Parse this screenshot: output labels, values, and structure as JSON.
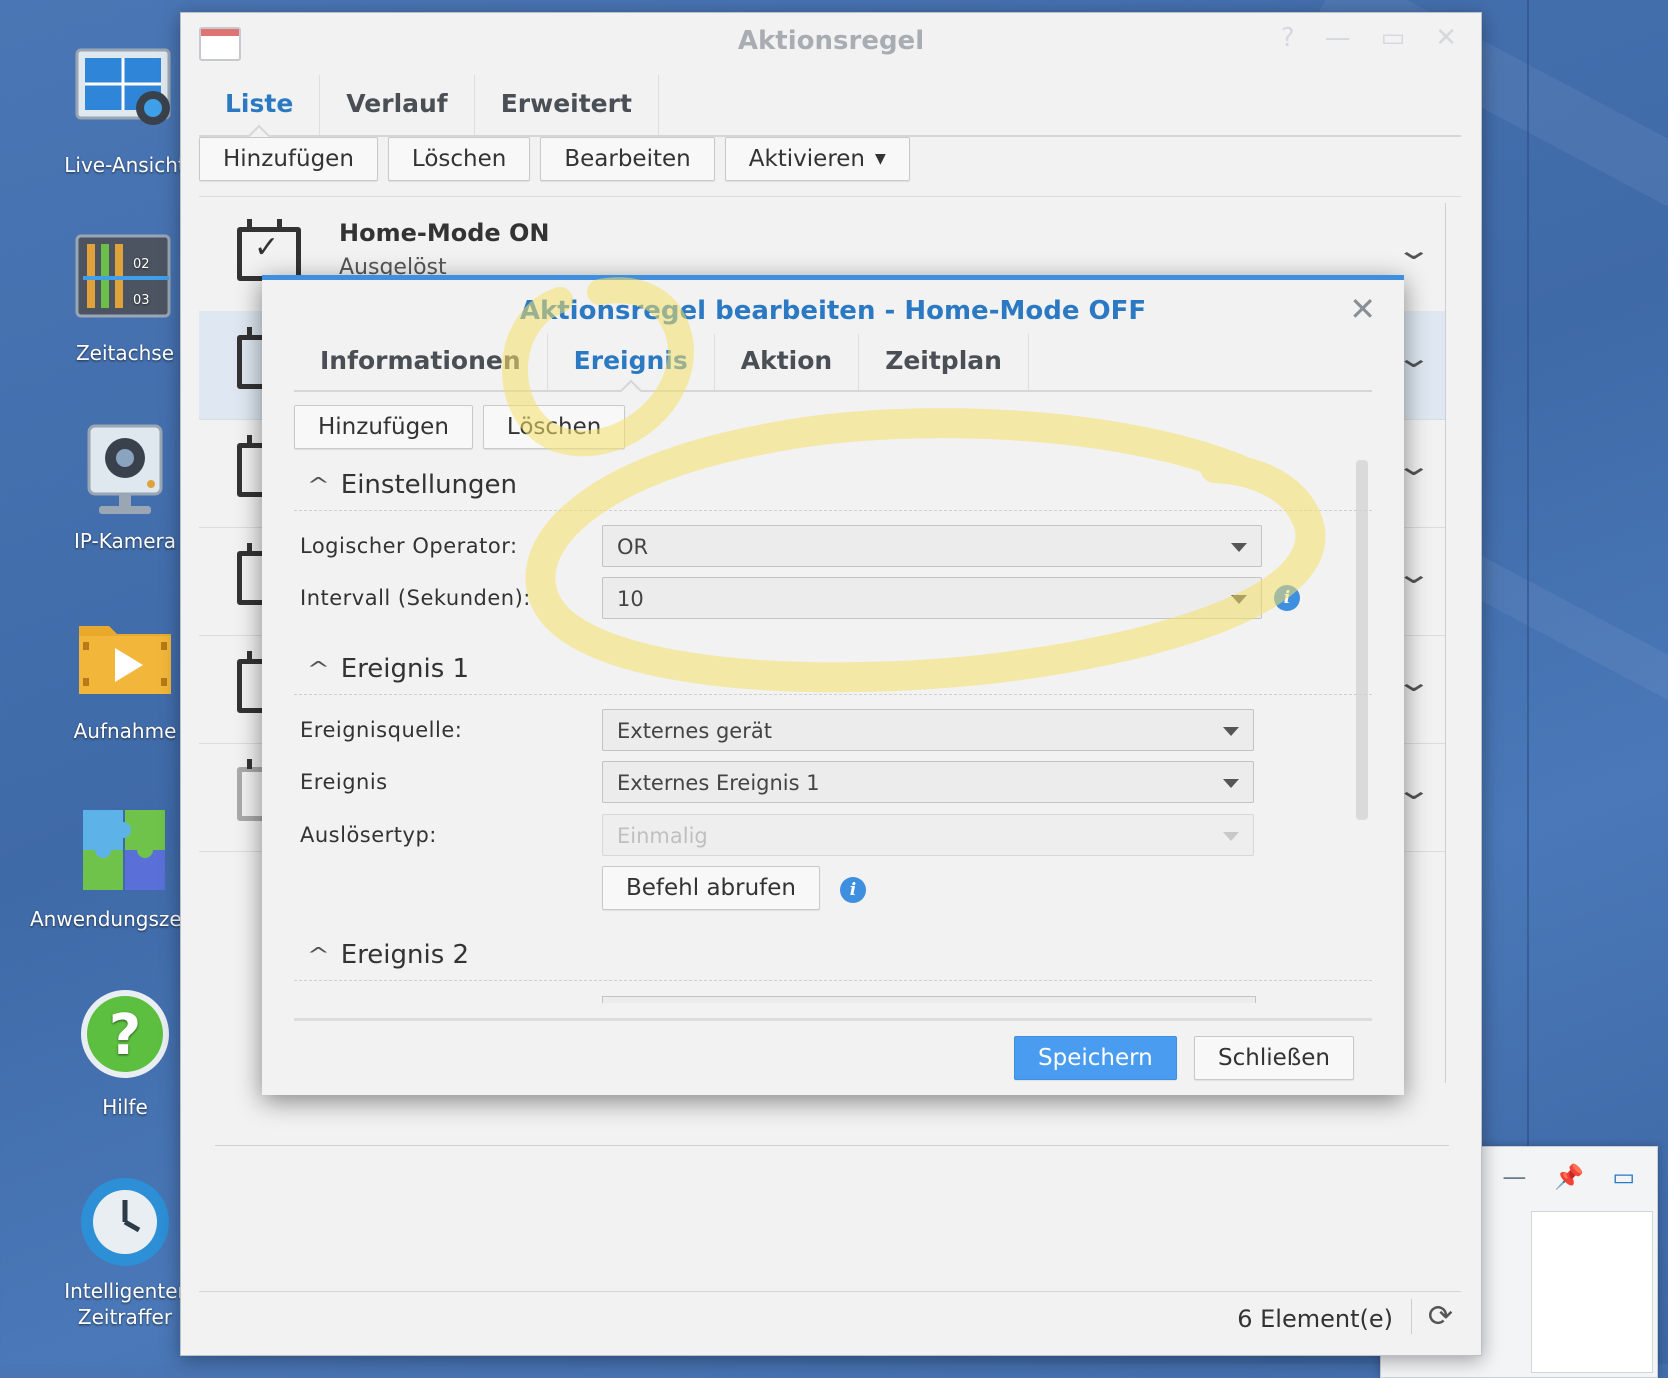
{
  "desktop": {
    "icons": [
      {
        "label": "Live-Ansicht"
      },
      {
        "label": "Zeitachse"
      },
      {
        "label": "IP-Kamera"
      },
      {
        "label": "Aufnahme"
      },
      {
        "label": "Anwendungszentrum"
      },
      {
        "label": "Hilfe"
      },
      {
        "label": "Intelligenter\nZeitraffer"
      }
    ],
    "timeline_marks": [
      "02",
      "03"
    ]
  },
  "window": {
    "title": "Aktionsregel",
    "controls": [
      "?",
      "—",
      "▭",
      "✕"
    ],
    "tabs": [
      {
        "label": "Liste"
      },
      {
        "label": "Verlauf"
      },
      {
        "label": "Erweitert"
      }
    ],
    "toolbar": {
      "add": "Hinzufügen",
      "delete": "Löschen",
      "edit": "Bearbeiten",
      "activate": "Aktivieren"
    },
    "rules": [
      {
        "name": "Home-Mode ON",
        "status": "Ausgelöst"
      }
    ],
    "footer": {
      "count": "6 Element(e)"
    }
  },
  "dialog": {
    "title": "Aktionsregel bearbeiten - Home-Mode OFF",
    "close": "✕",
    "tabs": [
      {
        "label": "Informationen"
      },
      {
        "label": "Ereignis"
      },
      {
        "label": "Aktion"
      },
      {
        "label": "Zeitplan"
      }
    ],
    "toolbar": {
      "add": "Hinzufügen",
      "delete": "Löschen"
    },
    "settings": {
      "heading": "Einstellungen",
      "operator_label": "Logischer Operator:",
      "operator_value": "OR",
      "interval_label": "Intervall (Sekunden):",
      "interval_value": "10"
    },
    "event1": {
      "heading": "Ereignis 1",
      "source_label": "Ereignisquelle:",
      "source_value": "Externes gerät",
      "event_label": "Ereignis",
      "event_value": "Externes Ereignis 1",
      "trigger_label": "Auslösertyp:",
      "trigger_value": "Einmalig",
      "fetch_button": "Befehl abrufen"
    },
    "event2": {
      "heading": "Ereignis 2"
    },
    "save": "Speichern",
    "close_button": "Schließen"
  },
  "colors": {
    "accent": "#2a79c2",
    "primary_button": "#4a9cf0",
    "highlighter": "#f5e06a"
  }
}
